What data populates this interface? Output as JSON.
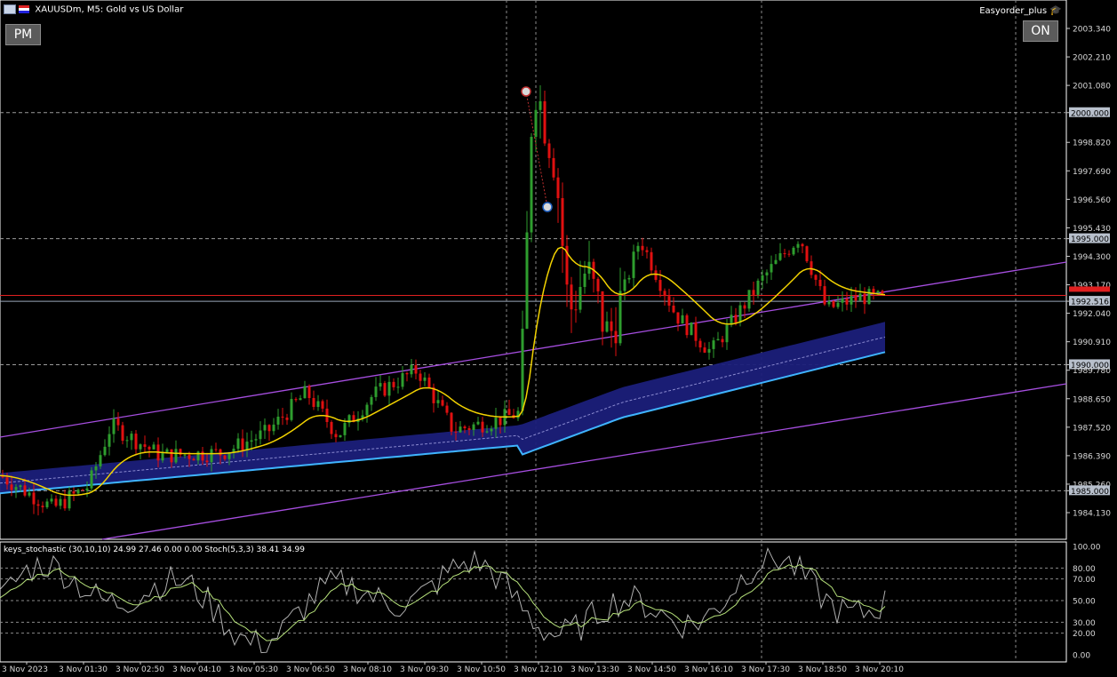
{
  "window": {
    "title": "XAUUSDm, M5:  Gold vs US Dollar",
    "expert_name": "Easyorder_plus",
    "pm_button": "PM",
    "on_button": "ON"
  },
  "indicator": {
    "label": "keys_stochastic (30,10,10) 24.99 27.46 0.00 0.00 Stoch(5,3,3) 38.41 34.99",
    "levels": [
      "100.00",
      "80.00",
      "70.00",
      "50.00",
      "30.00",
      "20.00",
      "0.00"
    ]
  },
  "chart_data": {
    "type": "candlestick",
    "symbol": "XAUUSDm",
    "timeframe": "M5",
    "ylim": [
      1983.3,
      2004.2
    ],
    "price_ticks": [
      "2003.340",
      "2002.210",
      "2001.080",
      "2000.000",
      "1998.820",
      "1997.690",
      "1996.560",
      "1995.430",
      "1995.000",
      "1994.300",
      "1993.170",
      "1992.516",
      "1992.040",
      "1990.910",
      "1990.000",
      "1989.780",
      "1988.650",
      "1987.520",
      "1986.390",
      "1985.260",
      "1985.000",
      "1984.130"
    ],
    "price_tick_values": [
      2003.34,
      2002.21,
      2001.08,
      2000.0,
      1998.82,
      1997.69,
      1996.56,
      1995.43,
      1995.0,
      1994.3,
      1993.17,
      1992.516,
      1992.04,
      1990.91,
      1990.0,
      1989.78,
      1988.65,
      1987.52,
      1986.39,
      1985.26,
      1985.0,
      1984.13
    ],
    "boxed_levels": [
      "2000.000",
      "1995.000",
      "1992.516",
      "1990.000",
      "1985.000"
    ],
    "current_bid_level": 1992.75,
    "current_ask_level": 1992.516,
    "time_labels": [
      "3 Nov 2023",
      "3 Nov 01:30",
      "3 Nov 02:50",
      "3 Nov 04:10",
      "3 Nov 05:30",
      "3 Nov 06:50",
      "3 Nov 08:10",
      "3 Nov 09:30",
      "3 Nov 10:50",
      "3 Nov 12:10",
      "3 Nov 13:30",
      "3 Nov 14:50",
      "3 Nov 16:10",
      "3 Nov 17:30",
      "3 Nov 18:50",
      "3 Nov 20:10"
    ],
    "bull_color": "#2e9d2e",
    "bear_color": "#e01010",
    "ema_color": "#f2d200",
    "band_fill": "#1b1f7a",
    "band_lower_color": "#3fb4ff",
    "channel_color": "#a64ee0",
    "stoch_main_color": "#b0b0b0",
    "stoch_signal_color": "#b5e07a"
  }
}
